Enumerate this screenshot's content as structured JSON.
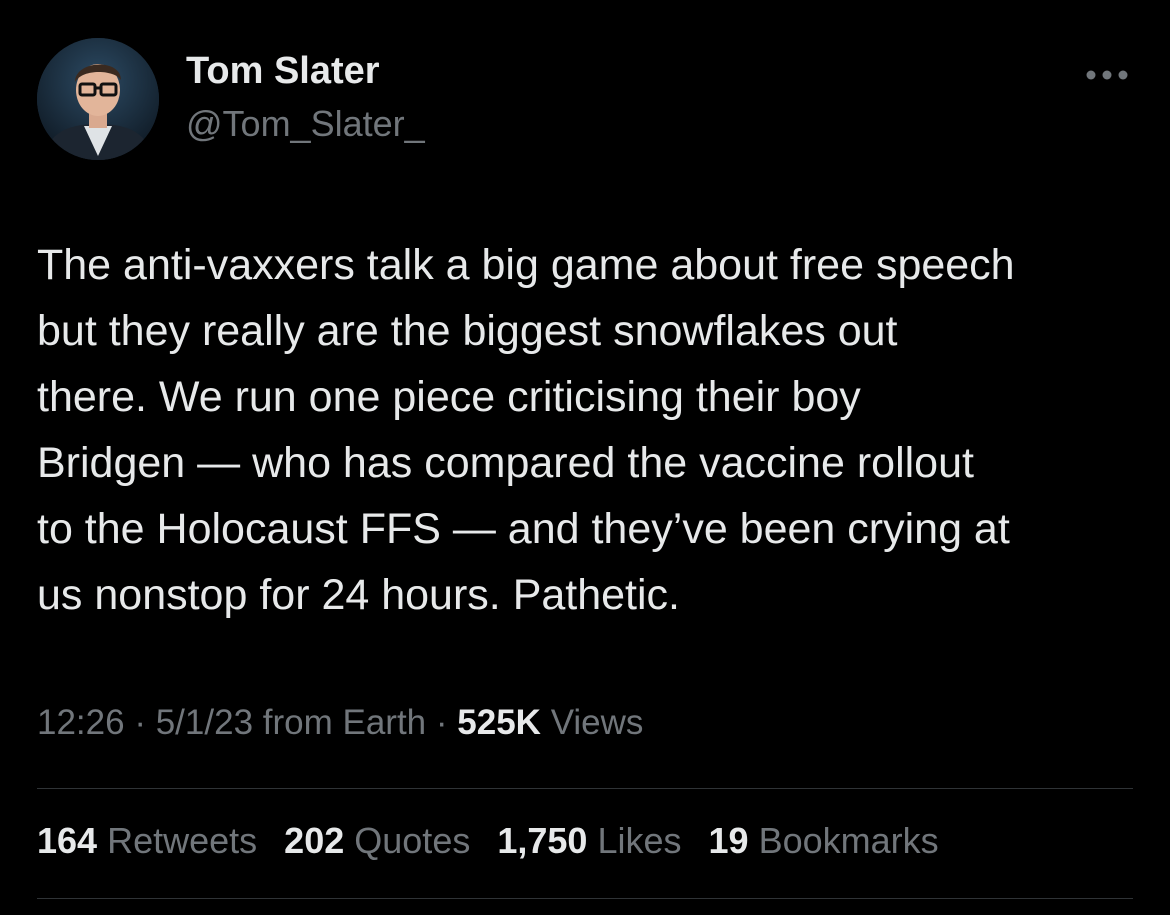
{
  "author": {
    "display_name": "Tom Slater",
    "handle": "@Tom_Slater_"
  },
  "tweet": {
    "text": "The anti-vaxxers talk a big game about free speech\nbut they really are the biggest snowflakes out\nthere. We run one piece criticising their boy\nBridgen — who has compared the vaccine rollout\nto the Holocaust FFS — and they’ve been crying at\nus nonstop for 24 hours. Pathetic.",
    "time": "12:26",
    "separator": "·",
    "date": "5/1/23",
    "source": "from Earth",
    "views_count": "525K",
    "views_label": "Views"
  },
  "stats": {
    "retweets": {
      "count": "164",
      "label": "Retweets"
    },
    "quotes": {
      "count": "202",
      "label": "Quotes"
    },
    "likes": {
      "count": "1,750",
      "label": "Likes"
    },
    "bookmarks": {
      "count": "19",
      "label": "Bookmarks"
    }
  },
  "icons": {
    "more": "more-horizontal-icon",
    "avatar": "profile-photo"
  },
  "colors": {
    "background": "#000000",
    "primary_text": "#e7e9ea",
    "secondary_text": "#71767b",
    "divider": "#2f3336"
  }
}
